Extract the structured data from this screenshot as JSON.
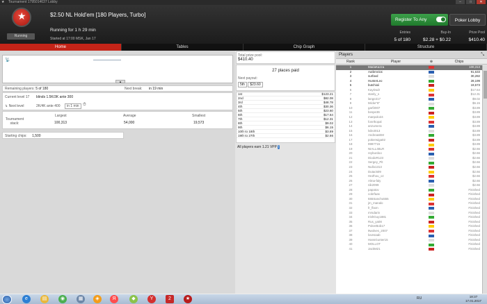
{
  "window": {
    "title": "Tournament 1795014637 Lobby"
  },
  "header": {
    "title": "$2.50 NL Hold'em [180 Players, Turbo]",
    "running_for": "Running for 1 h 29 min",
    "started": "Started at 17:00 MSK, Jan 17",
    "status_badge": "Running",
    "register_button": "Register To Any",
    "lobby_button": "Poker Lobby",
    "entries_label": "Entries",
    "entries_value": "5 of 180",
    "buyin_label": "Buy-In",
    "buyin_value": "$2.28 + $0.22",
    "prizepool_label": "Prize Pool",
    "prizepool_value": "$410.40"
  },
  "tabs": [
    {
      "label": "Home",
      "active": true
    },
    {
      "label": "Tables",
      "active": false
    },
    {
      "label": "Chip Graph",
      "active": false
    },
    {
      "label": "Structure",
      "active": false
    }
  ],
  "home": {
    "remaining_label": "Remaining players:",
    "remaining_value": "5 of 180",
    "next_break_label": "Next break:",
    "next_break_value": "in 19 min",
    "current_level_label": "Current level 17",
    "current_level_value": "blinds 1.5K/3K ante 300",
    "next_level_label": "Next level",
    "next_level_value": "2K/4K ante 400",
    "next_level_time": "in 1 min",
    "stack_label": "Tournament stack:",
    "largest_label": "Largest",
    "largest_value": "100,313",
    "average_label": "Average",
    "average_value": "54,000",
    "smallest_label": "Smallest",
    "smallest_value": "19,573",
    "starting_label": "Starting chips:",
    "starting_value": "1,500"
  },
  "prize": {
    "pool_label": "Total prize pool:",
    "pool_value": "$410.40",
    "places_paid": "27 places paid",
    "next_payout_label": "Next payout:",
    "next_payout_place": "5th",
    "next_payout_value": "$23.60",
    "rows": [
      {
        "place": "1st",
        "amount": "$123.21"
      },
      {
        "place": "2nd",
        "amount": "$82.08"
      },
      {
        "place": "3rd",
        "amount": "$48.78"
      },
      {
        "place": "4th",
        "amount": "$30.36"
      },
      {
        "place": "5th",
        "amount": "$23.60"
      },
      {
        "place": "6th",
        "amount": "$17.64"
      },
      {
        "place": "7th",
        "amount": "$12.31"
      },
      {
        "place": "8th",
        "amount": "$9.02"
      },
      {
        "place": "9th",
        "amount": "$6.15"
      },
      {
        "place": "10th to 18th",
        "amount": "$3.89"
      },
      {
        "place": "19th to 27th",
        "amount": "$2.66"
      }
    ],
    "vpp": "All players earn 1.21 VPP"
  },
  "players": {
    "title": "Players",
    "col_rank": "Rank",
    "col_player": "Player",
    "col_chips": "Chips",
    "rows": [
      {
        "rank": "1",
        "name": "MariaKazza",
        "chips": "100,313"
      },
      {
        "rank": "2",
        "name": "Autbrn41tc",
        "chips": "91,633"
      },
      {
        "rank": "3",
        "name": "surfavd",
        "chips": "30,282"
      },
      {
        "rank": "4",
        "name": "HunterLeo",
        "chips": "28,199"
      },
      {
        "rank": "5",
        "name": "butchioii",
        "chips": "19,573"
      },
      {
        "rank": "6",
        "name": "KayDodr",
        "chips": "$17.64"
      },
      {
        "rank": "7",
        "name": "stanly_s",
        "chips": "$12.31"
      },
      {
        "rank": "8",
        "name": "lange217",
        "chips": "$9.02"
      },
      {
        "rank": "9",
        "name": "Micke\"8\"",
        "chips": "$6.15"
      },
      {
        "rank": "10",
        "name": "garf2007",
        "chips": "$3.89"
      },
      {
        "rank": "11",
        "name": "bespe36",
        "chips": "$3.89"
      },
      {
        "rank": "12",
        "name": "manpolo24",
        "chips": "$3.89"
      },
      {
        "rank": "13",
        "name": "fonrthopal",
        "chips": "$3.89"
      },
      {
        "rank": "14",
        "name": "anzumera",
        "chips": "$3.89"
      },
      {
        "rank": "15",
        "name": "lvile2013",
        "chips": "$3.89"
      },
      {
        "rank": "16",
        "name": "AndreasEM",
        "chips": "$3.89"
      },
      {
        "rank": "17",
        "name": "pokerwiga02",
        "chips": "$3.89"
      },
      {
        "rank": "18",
        "name": "9997715",
        "chips": "$3.89"
      },
      {
        "rank": "19",
        "name": "NIALL4BLR",
        "chips": "$2.66"
      },
      {
        "rank": "20",
        "name": "reyburdoo",
        "chips": "$2.66"
      },
      {
        "rank": "21",
        "name": "DiodoR123",
        "chips": "$2.66"
      },
      {
        "rank": "22",
        "name": "Sergey_Pit",
        "chips": "$2.66"
      },
      {
        "rank": "23",
        "name": "Nullo1313",
        "chips": "$2.66"
      },
      {
        "rank": "24",
        "name": "Dutac509",
        "chips": "$2.66"
      },
      {
        "rank": "25",
        "name": "HeZhou_oz",
        "chips": "$2.66"
      },
      {
        "rank": "26",
        "name": "Alma-faly",
        "chips": "$2.66"
      },
      {
        "rank": "27",
        "name": "nik2099",
        "chips": "$2.66"
      },
      {
        "rank": "28",
        "name": "papatov",
        "chips": "Finished"
      },
      {
        "rank": "29",
        "name": "cobrfaas",
        "chips": "Finished"
      },
      {
        "rank": "30",
        "name": "555Sancho555",
        "chips": "Finished"
      },
      {
        "rank": "31",
        "name": "jm_manalo",
        "chips": "Finished"
      },
      {
        "rank": "32",
        "name": "fr_fbxm",
        "chips": "Finished"
      },
      {
        "rank": "33",
        "name": "mrsdarin",
        "chips": "Finished"
      },
      {
        "rank": "34",
        "name": "IrishGuy1881",
        "chips": "Finished"
      },
      {
        "rank": "35",
        "name": "Rus_ya08",
        "chips": "Finished"
      },
      {
        "rank": "36",
        "name": "PokerBob17",
        "chips": "Finished"
      },
      {
        "rank": "37",
        "name": "9wolves_2007",
        "chips": "Finished"
      },
      {
        "rank": "38",
        "name": "lovesaab",
        "chips": "Finished"
      },
      {
        "rank": "39",
        "name": "HansGunter15",
        "chips": "Finished"
      },
      {
        "rank": "40",
        "name": "MOLLOT",
        "chips": "Finished"
      },
      {
        "rank": "41",
        "name": "JackM21",
        "chips": "Finished"
      }
    ]
  },
  "taskbar": {
    "lang": "RU",
    "time": "18:37",
    "date": "17.01.2017"
  }
}
